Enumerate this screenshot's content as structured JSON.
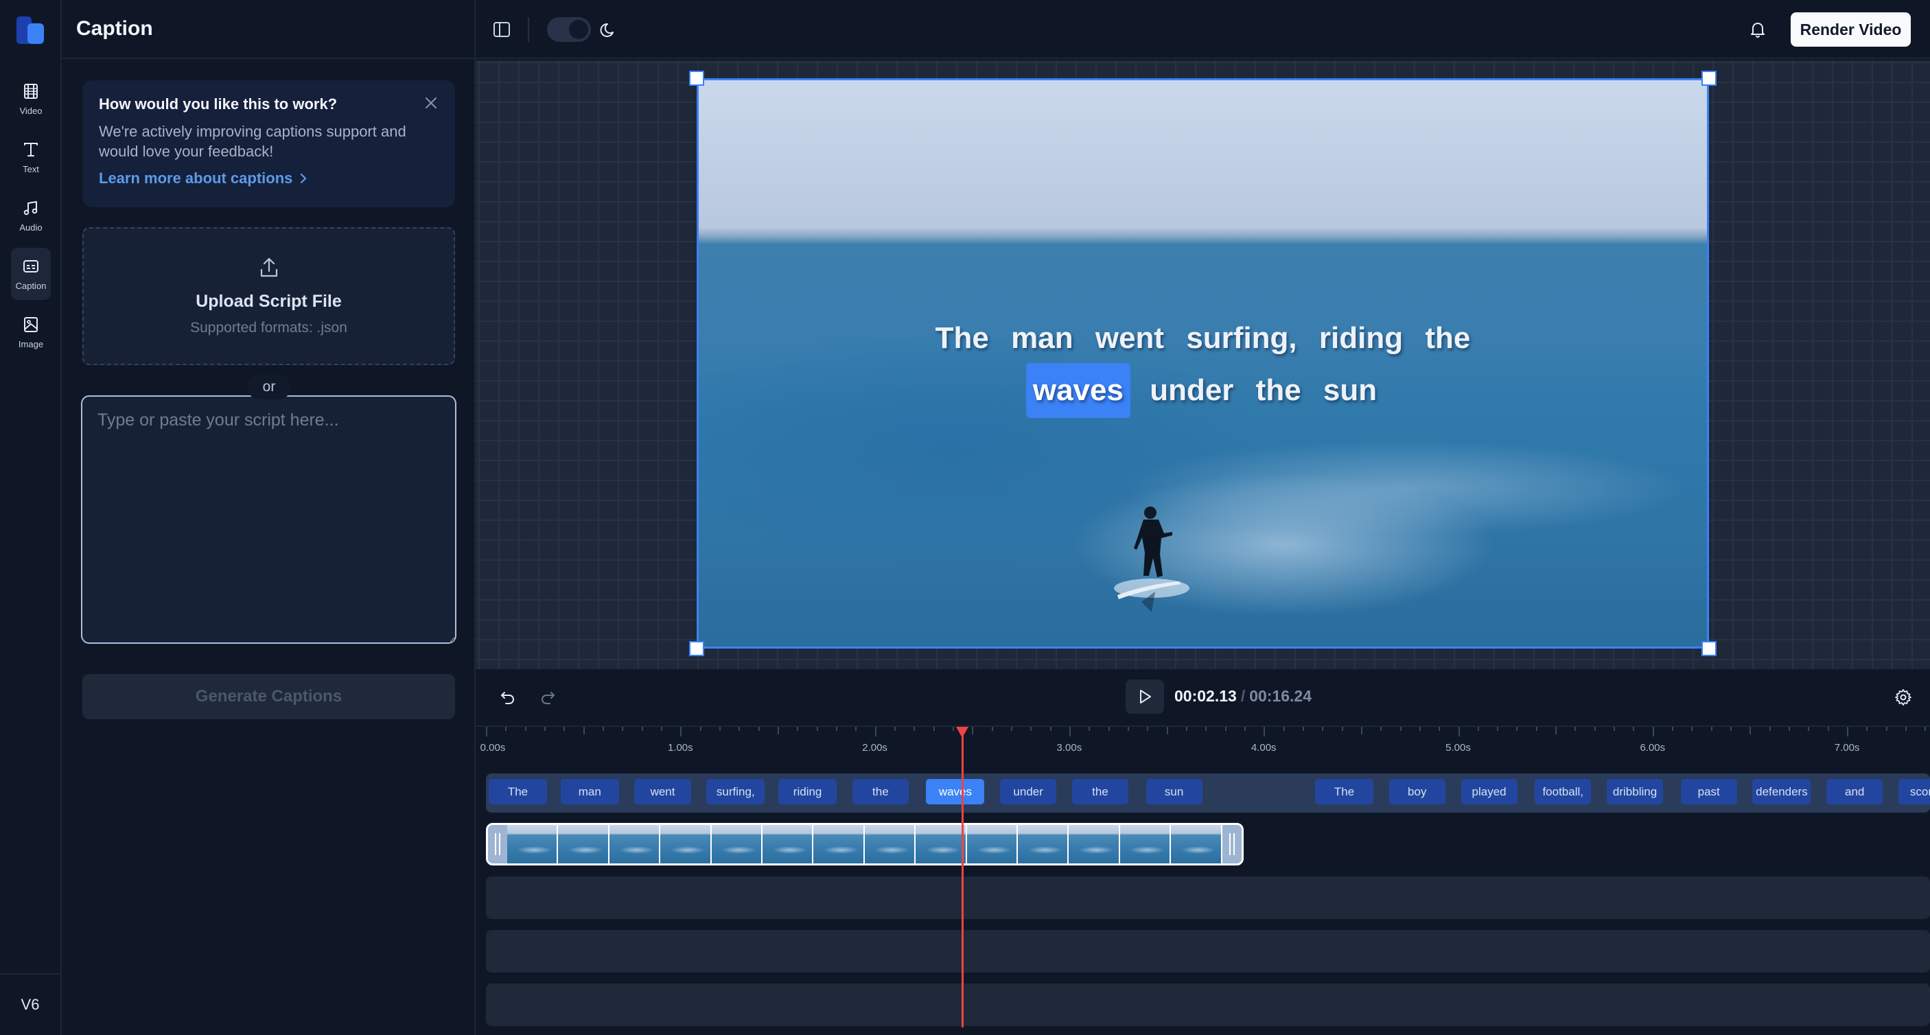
{
  "rail": {
    "items": [
      {
        "label": "Video",
        "icon": "film-icon"
      },
      {
        "label": "Text",
        "icon": "text-icon"
      },
      {
        "label": "Audio",
        "icon": "music-icon"
      },
      {
        "label": "Caption",
        "icon": "captions-icon",
        "active": true
      },
      {
        "label": "Image",
        "icon": "image-icon"
      }
    ],
    "version": "V6"
  },
  "panel": {
    "title": "Caption",
    "info_card": {
      "title": "How would you like this to work?",
      "body": "We're actively improving captions support and would love your feedback!",
      "link": "Learn more about captions"
    },
    "upload": {
      "title": "Upload Script File",
      "subtitle": "Supported formats: .json"
    },
    "divider_text": "or",
    "script_input": {
      "value": "",
      "placeholder": "Type or paste your script here..."
    },
    "generate_button": "Generate Captions"
  },
  "toolbar": {
    "render_button": "Render Video",
    "theme": "dark"
  },
  "preview": {
    "caption_lines": [
      [
        "The",
        "man",
        "went",
        "surfing,",
        "riding",
        "the"
      ],
      [
        "waves",
        "under",
        "the",
        "sun"
      ]
    ],
    "highlighted_word": "waves"
  },
  "playback": {
    "current_time": "00:02.13",
    "separator": "/",
    "total_time": "00:16.24",
    "playhead_seconds": 2.45
  },
  "timeline": {
    "ruler_labels": [
      "0.00s",
      "1.00s",
      "2.00s",
      "3.00s",
      "4.00s",
      "5.00s",
      "6.00s",
      "7.00s"
    ],
    "caption_words": [
      {
        "text": "The",
        "start": 0.0,
        "end": 0.3
      },
      {
        "text": "man",
        "start": 0.37,
        "end": 0.67
      },
      {
        "text": "went",
        "start": 0.75,
        "end": 1.04
      },
      {
        "text": "surfing,",
        "start": 1.12,
        "end": 1.42
      },
      {
        "text": "riding",
        "start": 1.49,
        "end": 1.79
      },
      {
        "text": "the",
        "start": 1.87,
        "end": 2.16
      },
      {
        "text": "waves",
        "start": 2.25,
        "end": 2.55,
        "active": true
      },
      {
        "text": "under",
        "start": 2.63,
        "end": 2.92
      },
      {
        "text": "the",
        "start": 3.0,
        "end": 3.29
      },
      {
        "text": "sun",
        "start": 3.38,
        "end": 3.67
      },
      {
        "text": "The",
        "start": 4.25,
        "end": 4.55
      },
      {
        "text": "boy",
        "start": 4.63,
        "end": 4.92
      },
      {
        "text": "played",
        "start": 5.0,
        "end": 5.29
      },
      {
        "text": "football,",
        "start": 5.38,
        "end": 5.67
      },
      {
        "text": "dribbling",
        "start": 5.75,
        "end": 6.04
      },
      {
        "text": "past",
        "start": 6.13,
        "end": 6.42
      },
      {
        "text": "defenders",
        "start": 6.5,
        "end": 6.8
      },
      {
        "text": "and",
        "start": 6.88,
        "end": 7.17
      },
      {
        "text": "scored",
        "start": 7.25,
        "end": 7.55
      }
    ],
    "video_clip": {
      "start": 0.0,
      "end": 3.72,
      "thumbnail_count": 14
    },
    "empty_tracks": 3
  },
  "colors": {
    "accent": "#3b82f6",
    "caption_chip": "#2246a0",
    "playhead": "#ef4444",
    "background": "#0f1727"
  }
}
